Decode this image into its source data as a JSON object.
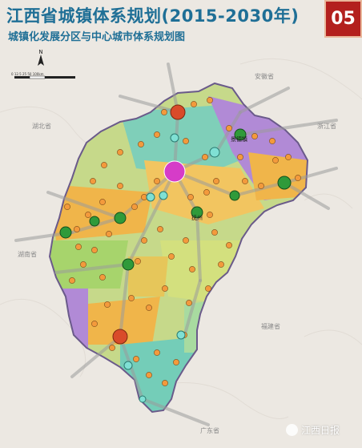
{
  "header": {
    "title": "江西省城镇体系规划(2015-2030年)",
    "subtitle": "城镇化发展分区与中心城市体系规划图",
    "badge": "05"
  },
  "legend": {
    "scale_text": "0 12.5 25   50      100km"
  },
  "labels": {
    "hubei": "湖北省",
    "anhui": "安徽省",
    "zhejiang": "浙江省",
    "fujian": "福建省",
    "hunan": "湖南省",
    "guangdong": "广东省",
    "jingdezhen": "景德镇",
    "fuzhou": "抚州"
  },
  "watermark": "江西日报",
  "colors": {
    "title": "#1f6f96",
    "badge": "#b3201e",
    "hub_major": "#d94b2a",
    "hub_primary": "#d63cc8",
    "hub_green": "#2f9a3a",
    "hub_cyan": "#7fe0d4",
    "town": "#f39a3c",
    "corridor": "#9a9a9a"
  }
}
